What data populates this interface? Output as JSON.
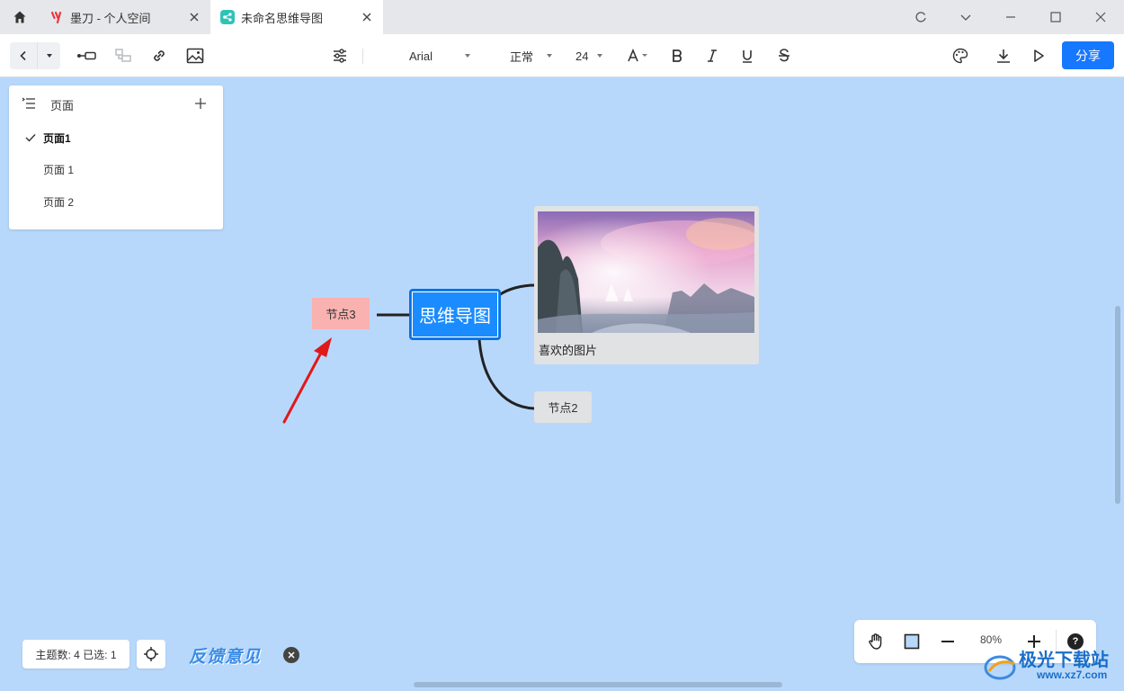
{
  "tabs": [
    {
      "title": "墨刀 - 个人空间",
      "icon": "modao-logo-icon"
    },
    {
      "title": "未命名思维导图",
      "icon": "mindmap-app-icon"
    }
  ],
  "toolbar": {
    "font_family": "Arial",
    "font_weight": "正常",
    "font_size": "24",
    "share_label": "分享"
  },
  "pages_panel": {
    "title": "页面",
    "items": [
      {
        "label": "页面1",
        "active": true
      },
      {
        "label": "页面 1",
        "active": false
      },
      {
        "label": "页面 2",
        "active": false
      }
    ]
  },
  "mindmap": {
    "central": "思维导图",
    "nodes": [
      {
        "label": "节点3",
        "color": "#f9b2b0"
      },
      {
        "label": "喜欢的图片",
        "type": "image"
      },
      {
        "label": "节点2",
        "color": "#e1e2e3"
      }
    ]
  },
  "status": {
    "stats": "主题数: 4 已选: 1",
    "feedback": "反馈意见",
    "zoom": "80%",
    "help": "?"
  },
  "watermark": {
    "text": "极光下载站",
    "url": "www.xz7.com"
  },
  "colors": {
    "accent": "#1677ff",
    "canvas": "#b8d8fb",
    "central_node": "#1a8cff"
  }
}
